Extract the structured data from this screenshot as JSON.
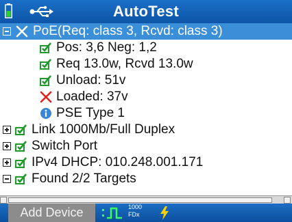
{
  "header": {
    "title": "AutoTest",
    "battery_icon": "battery-icon",
    "usb_icon": "usb-icon"
  },
  "tree": {
    "items": [
      {
        "label": "PoE(Req: class 3, Rcvd: class 3)",
        "status": "fail",
        "expander": "collapse",
        "selected": true
      },
      {
        "label": "Pos: 3,6 Neg: 1,2",
        "status": "pass"
      },
      {
        "label": "Req 13.0w, Rcvd 13.0w",
        "status": "pass"
      },
      {
        "label": "Unload: 51v",
        "status": "pass"
      },
      {
        "label": "Loaded: 37v",
        "status": "fail"
      },
      {
        "label": "PSE Type 1",
        "status": "info"
      },
      {
        "label": "Link 1000Mb/Full Duplex",
        "status": "pass",
        "expander": "expand"
      },
      {
        "label": "Switch Port",
        "status": "pass",
        "expander": "expand"
      },
      {
        "label": "IPv4 DHCP: 010.248.001.171",
        "status": "pass",
        "expander": "expand"
      },
      {
        "label": "Found 2/2 Targets",
        "status": "pass",
        "expander": "collapse"
      }
    ]
  },
  "bottom": {
    "add_button_label": "Add Device",
    "link_speed": "1000",
    "duplex": "FDx"
  },
  "colors": {
    "title_bar": "#0d55a8",
    "selected_row": "#3b8fd9",
    "pass_green": "#1e9a2a",
    "fail_red": "#e0201b",
    "info_blue": "#3a86d6",
    "bolt_yellow": "#f5d000"
  }
}
